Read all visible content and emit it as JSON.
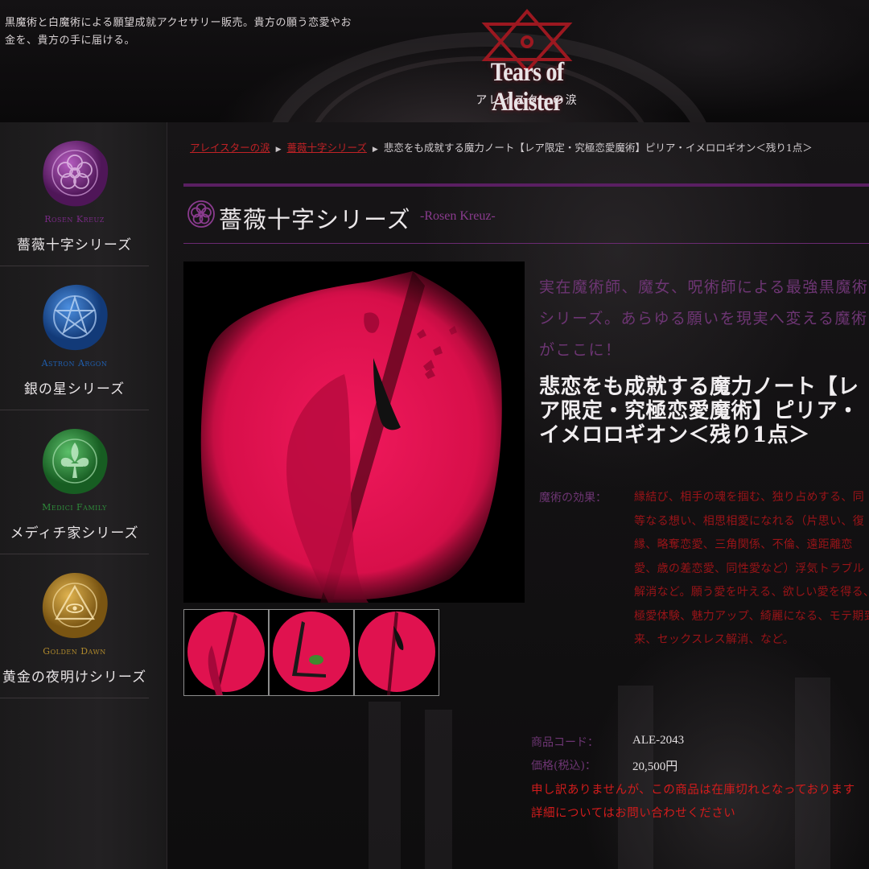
{
  "header": {
    "tagline": "黒魔術と白魔術による願望成就アクセサリー販売。貴方の願う恋愛やお金を、貴方の手に届ける。",
    "logo_title": "Tears of Aleister",
    "logo_subtitle": "アレイスターの涙"
  },
  "sidebar": {
    "items": [
      {
        "en": "Rosen Kreuz",
        "jp": "薔薇十字シリーズ",
        "color": "#7a2a86",
        "icon": "rose-seal-icon"
      },
      {
        "en": "Astron Argon",
        "jp": "銀の星シリーズ",
        "color": "#1f5fb0",
        "icon": "pentagram-seal-icon"
      },
      {
        "en": "Medici Family",
        "jp": "メディチ家シリーズ",
        "color": "#2e8b3a",
        "icon": "fleur-de-lis-seal-icon"
      },
      {
        "en": "Golden Dawn",
        "jp": "黄金の夜明けシリーズ",
        "color": "#b08a2c",
        "icon": "eye-of-providence-seal-icon"
      }
    ]
  },
  "breadcrumb": {
    "home": "アレイスターの涙",
    "series": "薔薇十字シリーズ",
    "current": "悲恋をも成就する魔力ノート【レア限定・究極恋愛魔術】ピリア・イメロロギオン＜残り1点＞"
  },
  "series_heading": {
    "jp": "薔薇十字シリーズ",
    "en": "-Rosen Kreuz-"
  },
  "product": {
    "lead": "実在魔術師、魔女、呪術師による最強黒魔術シリーズ。あらゆる願いを現実へ変える魔術がここに！",
    "name": "悲恋をも成就する魔力ノート【レア限定・究極恋愛魔術】ピリア・イメロロギオン＜残り1点＞",
    "effect_label": "魔術の効果：",
    "effect_text": "縁結び、相手の魂を掴む、独り占めする、同等なる想い、相思相愛になれる（片思い、復縁、略奪恋愛、三角関係、不倫、遠距離恋愛、歳の差恋愛、同性愛など）浮気トラブル解消など。願う愛を叶える、欲しい愛を得る、極愛体験、魅力アップ、綺麗になる、モテ期到来、セックスレス解消、など。",
    "code_label": "商品コード：",
    "code_value": "ALE-2043",
    "price_label": "価格(税込)：",
    "price_value": "20,500円",
    "notice_1": "申し訳ありませんが、この商品は在庫切れとなっております",
    "notice_2": "詳細についてはお問い合わせください"
  },
  "colors": {
    "accent_purple": "#6d3573",
    "link_red": "#c02226",
    "notice_red": "#d21c1c",
    "photo_pink": "#e0124f"
  }
}
